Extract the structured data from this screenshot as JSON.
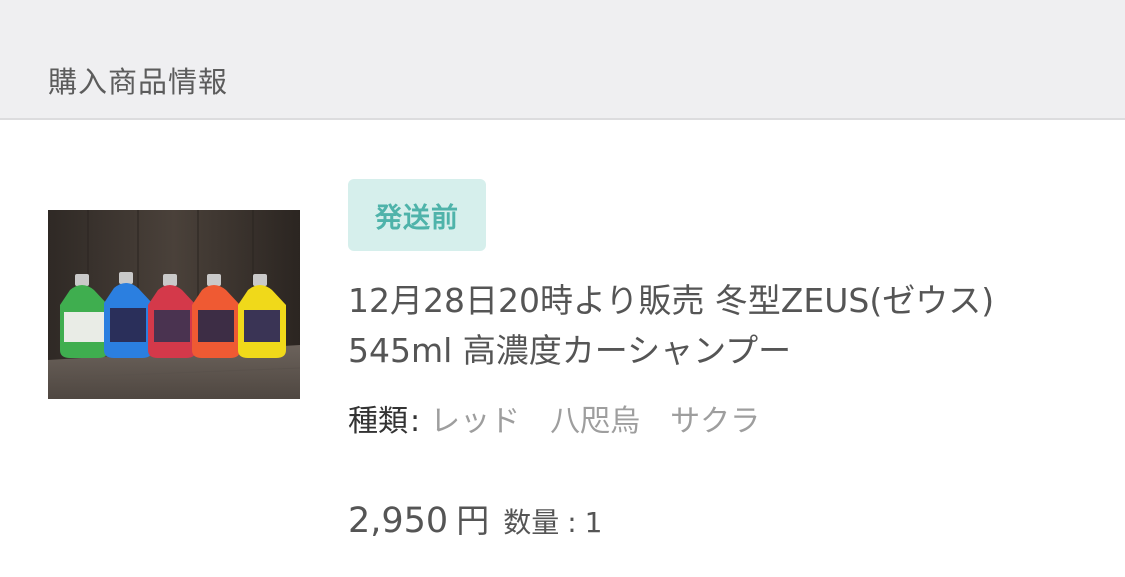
{
  "section": {
    "title": "購入商品情報"
  },
  "product": {
    "image_alt": "5本のカーシャンプーボトル",
    "status": "発送前",
    "title": "12月28日20時より販売 冬型ZEUS(ゼウス) 545ml 高濃度カーシャンプー",
    "variant": {
      "label": "種類",
      "separator": ":",
      "value": "レッド　八咫烏　サクラ"
    },
    "price": "2,950",
    "price_unit": "円",
    "quantity": {
      "label": "数量",
      "separator": ":",
      "value": "1"
    }
  },
  "colors": {
    "header_bg": "#efeff1",
    "badge_bg": "#d6efec",
    "badge_text": "#4fb3aa",
    "text_main": "#555555",
    "text_muted": "#9e9e9e"
  }
}
